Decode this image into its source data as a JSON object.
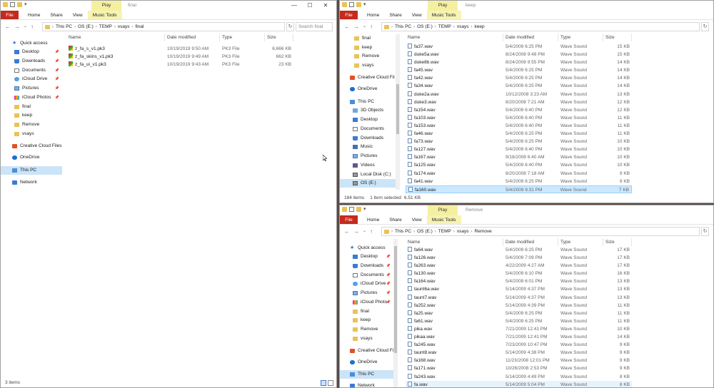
{
  "w1": {
    "title": "final",
    "play_tab": "Play",
    "music_tools": "Music Tools",
    "controls": [
      "—",
      "☐",
      "✕"
    ],
    "ribbon": [
      "File",
      "Home",
      "Share",
      "View",
      "Music Tools"
    ],
    "path": [
      "This PC",
      "OS (E:)",
      "TEMP",
      "vsays",
      "final"
    ],
    "search": "Search final",
    "columns": [
      "Name",
      "Date modified",
      "Type",
      "Size"
    ],
    "files": [
      {
        "name": "z_fa_s_v1.pk3",
        "date": "10/19/2019 9:50 AM",
        "type": "PK3 File",
        "size": "6,666 KB"
      },
      {
        "name": "z_fa_skins_v1.pk3",
        "date": "10/19/2019 9:49 AM",
        "type": "PK3 File",
        "size": "662 KB"
      },
      {
        "name": "z_fa_ui_v1.pk3",
        "date": "10/19/2019 9:43 AM",
        "type": "PK3 File",
        "size": "23 KB"
      }
    ],
    "sidebar": [
      {
        "label": "Quick access",
        "icon": "star-icon"
      },
      {
        "label": "Desktop",
        "icon": "desktop-icon",
        "pin": true
      },
      {
        "label": "Downloads",
        "icon": "downloads-icon",
        "pin": true
      },
      {
        "label": "Documents",
        "icon": "documents-icon",
        "pin": true
      },
      {
        "label": "iCloud Drive",
        "icon": "icloud-icon",
        "pin": true
      },
      {
        "label": "Pictures",
        "icon": "pictures-icon",
        "pin": true
      },
      {
        "label": "iCloud Photos",
        "icon": "photos-icon",
        "pin": true
      },
      {
        "label": "final",
        "icon": "folder-icon"
      },
      {
        "label": "keep",
        "icon": "folder-icon"
      },
      {
        "label": "Remove",
        "icon": "folder-icon"
      },
      {
        "label": "vsays",
        "icon": "folder-icon"
      },
      {
        "label": "Creative Cloud Files",
        "icon": "creative-cloud-icon"
      },
      {
        "label": "OneDrive",
        "icon": "onedrive-icon"
      },
      {
        "label": "This PC",
        "icon": "this-pc-icon",
        "selected": true
      },
      {
        "label": "Network",
        "icon": "network-icon"
      }
    ],
    "status": "3 items"
  },
  "w2": {
    "title": "keep",
    "play_tab": "Play",
    "music_tools": "Music Tools",
    "ribbon": [
      "File",
      "Home",
      "Share",
      "View",
      "Music Tools"
    ],
    "path": [
      "This PC",
      "OS (E:)",
      "TEMP",
      "vsays",
      "keep"
    ],
    "columns": [
      "Name",
      "Date modified",
      "Type",
      "Size"
    ],
    "files": [
      {
        "name": "fa37.wav",
        "date": "5/4/2009 6:25 PM",
        "type": "Wave Sound",
        "size": "15 KB"
      },
      {
        "name": "duke5a.wav",
        "date": "8/24/2008 9:48 PM",
        "type": "Wave Sound",
        "size": "15 KB"
      },
      {
        "name": "duke8b.wav",
        "date": "8/24/2008 9:55 PM",
        "type": "Wave Sound",
        "size": "14 KB"
      },
      {
        "name": "fa45.wav",
        "date": "5/4/2009 6:25 PM",
        "type": "Wave Sound",
        "size": "14 KB"
      },
      {
        "name": "fa42.wav",
        "date": "5/4/2009 6:25 PM",
        "type": "Wave Sound",
        "size": "14 KB"
      },
      {
        "name": "fa34.wav",
        "date": "5/4/2009 6:25 PM",
        "type": "Wave Sound",
        "size": "14 KB"
      },
      {
        "name": "duke2a.wav",
        "date": "10/12/2008 3:23 AM",
        "type": "Wave Sound",
        "size": "13 KB"
      },
      {
        "name": "duke3.wav",
        "date": "8/20/2008 7:21 AM",
        "type": "Wave Sound",
        "size": "12 KB"
      },
      {
        "name": "fa154.wav",
        "date": "5/4/2009 6:40 PM",
        "type": "Wave Sound",
        "size": "12 KB"
      },
      {
        "name": "fa103.wav",
        "date": "5/4/2009 6:40 PM",
        "type": "Wave Sound",
        "size": "11 KB"
      },
      {
        "name": "fa153.wav",
        "date": "5/4/2009 6:40 PM",
        "type": "Wave Sound",
        "size": "11 KB"
      },
      {
        "name": "fa46.wav",
        "date": "5/4/2009 6:25 PM",
        "type": "Wave Sound",
        "size": "11 KB"
      },
      {
        "name": "fa73.wav",
        "date": "5/4/2009 6:25 PM",
        "type": "Wave Sound",
        "size": "10 KB"
      },
      {
        "name": "fa127.wav",
        "date": "5/4/2009 6:40 PM",
        "type": "Wave Sound",
        "size": "10 KB"
      },
      {
        "name": "fa167.wav",
        "date": "9/18/2008 6:40 AM",
        "type": "Wave Sound",
        "size": "10 KB"
      },
      {
        "name": "fa125.wav",
        "date": "5/4/2009 6:40 PM",
        "type": "Wave Sound",
        "size": "10 KB"
      },
      {
        "name": "fa174.wav",
        "date": "8/20/2008 7:18 AM",
        "type": "Wave Sound",
        "size": "9 KB"
      },
      {
        "name": "fa41.wav",
        "date": "5/4/2009 6:25 PM",
        "type": "Wave Sound",
        "size": "9 KB"
      },
      {
        "name": "fa160.wav",
        "date": "5/4/2009 9:31 PM",
        "type": "Wave Sound",
        "size": "7 KB",
        "selected": true
      }
    ],
    "sidebar": [
      {
        "label": "final",
        "icon": "folder-icon"
      },
      {
        "label": "keep",
        "icon": "folder-icon"
      },
      {
        "label": "Remove",
        "icon": "folder-icon"
      },
      {
        "label": "vsays",
        "icon": "folder-icon"
      },
      {
        "label": "Creative Cloud Fil",
        "icon": "creative-cloud-icon"
      },
      {
        "label": "OneDrive",
        "icon": "onedrive-icon"
      },
      {
        "label": "This PC",
        "icon": "this-pc-icon"
      },
      {
        "label": "3D Objects",
        "icon": "3d-objects-icon"
      },
      {
        "label": "Desktop",
        "icon": "desktop-icon"
      },
      {
        "label": "Documents",
        "icon": "documents-icon"
      },
      {
        "label": "Downloads",
        "icon": "downloads-icon"
      },
      {
        "label": "Music",
        "icon": "music-icon"
      },
      {
        "label": "Pictures",
        "icon": "pictures-icon"
      },
      {
        "label": "Videos",
        "icon": "videos-icon"
      },
      {
        "label": "Local Disk (C:)",
        "icon": "drive-icon"
      },
      {
        "label": "OS (E:)",
        "icon": "drive-icon",
        "selected": true
      }
    ],
    "status_items": "184 items",
    "status_selected": "1 item selected",
    "status_size": "6.51 KB"
  },
  "w3": {
    "play_tab": "Play",
    "title": "Remove",
    "ribbon": [
      "File",
      "Home",
      "Share",
      "View",
      "Music Tools"
    ],
    "path": [
      "This PC",
      "OS (E:)",
      "TEMP",
      "vsays",
      "Remove"
    ],
    "columns": [
      "Name",
      "Date modified",
      "Type",
      "Size"
    ],
    "files": [
      {
        "name": "fa64.wav",
        "date": "5/4/2009 6:25 PM",
        "type": "Wave Sound",
        "size": "17 KB"
      },
      {
        "name": "fa126.wav",
        "date": "5/4/2009 7:09 PM",
        "type": "Wave Sound",
        "size": "17 KB"
      },
      {
        "name": "fa263.wav",
        "date": "4/22/2009 4:27 AM",
        "type": "Wave Sound",
        "size": "17 KB"
      },
      {
        "name": "fa130.wav",
        "date": "5/4/2009 6:10 PM",
        "type": "Wave Sound",
        "size": "16 KB"
      },
      {
        "name": "fa164.wav",
        "date": "5/4/2009 6:01 PM",
        "type": "Wave Sound",
        "size": "13 KB"
      },
      {
        "name": "taunt6a.wav",
        "date": "5/14/2009 4:37 PM",
        "type": "Wave Sound",
        "size": "13 KB"
      },
      {
        "name": "taunt7.wav",
        "date": "5/14/2009 4:37 PM",
        "type": "Wave Sound",
        "size": "13 KB"
      },
      {
        "name": "fa252.wav",
        "date": "5/14/2009 4:39 PM",
        "type": "Wave Sound",
        "size": "11 KB"
      },
      {
        "name": "fa25.wav",
        "date": "5/4/2009 6:25 PM",
        "type": "Wave Sound",
        "size": "11 KB"
      },
      {
        "name": "fa61.wav",
        "date": "5/4/2009 6:25 PM",
        "type": "Wave Sound",
        "size": "11 KB"
      },
      {
        "name": "pika.wav",
        "date": "7/21/2009 12:41 PM",
        "type": "Wave Sound",
        "size": "10 KB"
      },
      {
        "name": "pikaa.wav",
        "date": "7/21/2009 12:41 PM",
        "type": "Wave Sound",
        "size": "14 KB"
      },
      {
        "name": "fa245.wav",
        "date": "7/23/2009 10:47 PM",
        "type": "Wave Sound",
        "size": "9 KB"
      },
      {
        "name": "taunt8.wav",
        "date": "5/14/2009 4:38 PM",
        "type": "Wave Sound",
        "size": "9 KB"
      },
      {
        "name": "fa168.wav",
        "date": "11/23/2008 12:01 PM",
        "type": "Wave Sound",
        "size": "9 KB"
      },
      {
        "name": "fa171.wav",
        "date": "10/26/2008 2:53 PM",
        "type": "Wave Sound",
        "size": "9 KB"
      },
      {
        "name": "fa243.wav",
        "date": "5/14/2009 4:49 PM",
        "type": "Wave Sound",
        "size": "8 KB"
      },
      {
        "name": "fa.wav",
        "date": "5/14/2009 5:04 PM",
        "type": "Wave Sound",
        "size": "8 KB",
        "hover": true
      }
    ],
    "sidebar": [
      {
        "label": "Quick access",
        "icon": "star-icon"
      },
      {
        "label": "Desktop",
        "icon": "desktop-icon",
        "pin": true
      },
      {
        "label": "Downloads",
        "icon": "downloads-icon",
        "pin": true
      },
      {
        "label": "Documents",
        "icon": "documents-icon",
        "pin": true
      },
      {
        "label": "iCloud Drive",
        "icon": "icloud-icon",
        "pin": true
      },
      {
        "label": "Pictures",
        "icon": "pictures-icon",
        "pin": true
      },
      {
        "label": "iCloud Photo",
        "icon": "photos-icon",
        "pin": true
      },
      {
        "label": "final",
        "icon": "folder-icon"
      },
      {
        "label": "keep",
        "icon": "folder-icon"
      },
      {
        "label": "Remove",
        "icon": "folder-icon"
      },
      {
        "label": "vsays",
        "icon": "folder-icon"
      },
      {
        "label": "Creative Cloud File",
        "icon": "creative-cloud-icon"
      },
      {
        "label": "OneDrive",
        "icon": "onedrive-icon"
      },
      {
        "label": "This PC",
        "icon": "this-pc-icon",
        "selected": true
      },
      {
        "label": "Network",
        "icon": "network-icon"
      }
    ]
  }
}
